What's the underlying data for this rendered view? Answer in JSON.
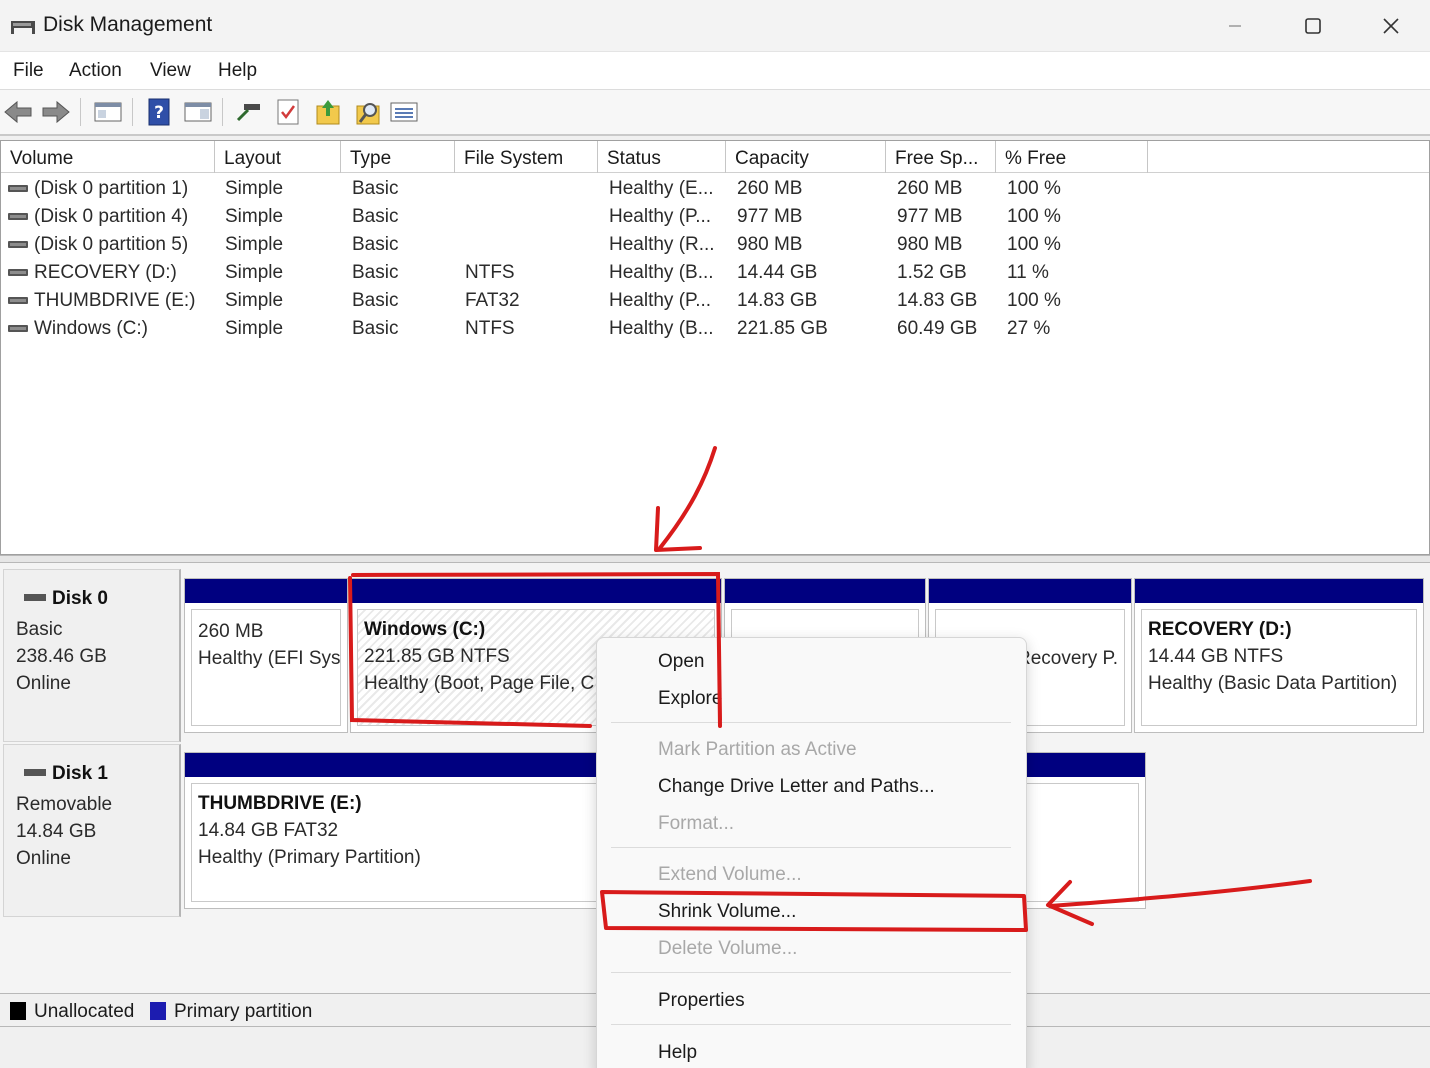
{
  "window": {
    "title": "Disk Management"
  },
  "menu": [
    "File",
    "Action",
    "View",
    "Help"
  ],
  "toolbar_icons": [
    "back-arrow-icon",
    "forward-arrow-icon",
    "console-view-icon",
    "help-icon",
    "properties-pane-icon",
    "connect-icon",
    "checklist-icon",
    "import-icon",
    "search-disk-icon",
    "list-view-icon"
  ],
  "volume_table": {
    "columns": [
      "Volume",
      "Layout",
      "Type",
      "File System",
      "Status",
      "Capacity",
      "Free Sp...",
      "% Free"
    ],
    "rows": [
      [
        "(Disk 0 partition 1)",
        "Simple",
        "Basic",
        "",
        "Healthy (E...",
        "260 MB",
        "260 MB",
        "100 %"
      ],
      [
        "(Disk 0 partition 4)",
        "Simple",
        "Basic",
        "",
        "Healthy (P...",
        "977 MB",
        "977 MB",
        "100 %"
      ],
      [
        "(Disk 0 partition 5)",
        "Simple",
        "Basic",
        "",
        "Healthy (R...",
        "980 MB",
        "980 MB",
        "100 %"
      ],
      [
        "RECOVERY (D:)",
        "Simple",
        "Basic",
        "NTFS",
        "Healthy (B...",
        "14.44 GB",
        "1.52 GB",
        "11 %"
      ],
      [
        "THUMBDRIVE (E:)",
        "Simple",
        "Basic",
        "FAT32",
        "Healthy (P...",
        "14.83 GB",
        "14.83 GB",
        "100 %"
      ],
      [
        "Windows (C:)",
        "Simple",
        "Basic",
        "NTFS",
        "Healthy (B...",
        "221.85 GB",
        "60.49 GB",
        "27 %"
      ]
    ]
  },
  "disks": [
    {
      "name": "Disk 0",
      "type": "Basic",
      "size": "238.46 GB",
      "state": "Online",
      "partitions": [
        {
          "title": "",
          "line1": "260 MB",
          "line2": "Healthy (EFI Sys"
        },
        {
          "title": "Windows  (C:)",
          "line1": "221.85 GB NTFS",
          "line2": "Healthy (Boot, Page File, C"
        },
        {
          "title": "",
          "line1": "",
          "line2": ""
        },
        {
          "title": "",
          "line1": "",
          "line2": "Recovery P."
        },
        {
          "title": "RECOVERY  (D:)",
          "line1": "14.44 GB NTFS",
          "line2": "Healthy (Basic Data Partition)"
        }
      ]
    },
    {
      "name": "Disk 1",
      "type": "Removable",
      "size": "14.84 GB",
      "state": "Online",
      "partitions": [
        {
          "title": "THUMBDRIVE  (E:)",
          "line1": "14.84 GB FAT32",
          "line2": "Healthy (Primary Partition)"
        }
      ]
    }
  ],
  "legend": [
    {
      "label": "Unallocated",
      "color": "#000000"
    },
    {
      "label": "Primary partition",
      "color": "#1c1cb0"
    }
  ],
  "context_menu": {
    "items": [
      {
        "label": "Open",
        "enabled": true
      },
      {
        "label": "Explore",
        "enabled": true
      },
      {
        "label": "Mark Partition as Active",
        "enabled": false
      },
      {
        "label": "Change Drive Letter and Paths...",
        "enabled": true
      },
      {
        "label": "Format...",
        "enabled": false
      },
      {
        "label": "Extend Volume...",
        "enabled": false
      },
      {
        "label": "Shrink Volume...",
        "enabled": true
      },
      {
        "label": "Delete Volume...",
        "enabled": false
      },
      {
        "label": "Properties",
        "enabled": true
      },
      {
        "label": "Help",
        "enabled": true
      }
    ]
  },
  "colors": {
    "partition_bar": "#000080",
    "annotation": "#d81b1b"
  }
}
